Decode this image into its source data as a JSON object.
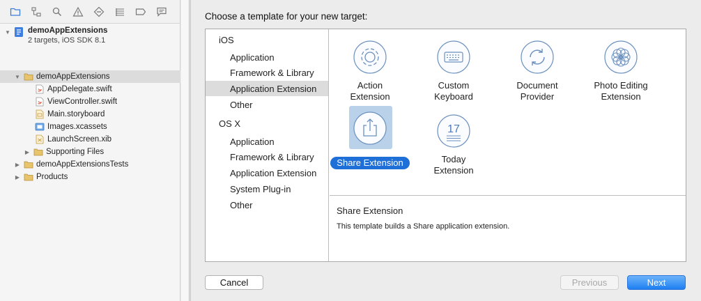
{
  "navigator": {
    "toolbar_icons": [
      "folder-icon",
      "hierarchy-icon",
      "search-icon",
      "warning-icon",
      "test-icon",
      "debug-icon",
      "breakpoint-icon",
      "report-icon"
    ],
    "project": {
      "name": "demoAppExtensions",
      "subtitle": "2 targets, iOS SDK 8.1"
    },
    "items": [
      {
        "label": "demoAppExtensions"
      },
      {
        "label": "AppDelegate.swift"
      },
      {
        "label": "ViewController.swift"
      },
      {
        "label": "Main.storyboard"
      },
      {
        "label": "Images.xcassets"
      },
      {
        "label": "LaunchScreen.xib"
      },
      {
        "label": "Supporting Files"
      },
      {
        "label": "demoAppExtensionsTests"
      },
      {
        "label": "Products"
      }
    ]
  },
  "sheet": {
    "title": "Choose a template for your new target:",
    "sidebar": {
      "ios_header": "iOS",
      "ios_items": [
        "Application",
        "Framework & Library",
        "Application Extension",
        "Other"
      ],
      "osx_header": "OS X",
      "osx_items": [
        "Application",
        "Framework & Library",
        "Application Extension",
        "System Plug-in",
        "Other"
      ]
    },
    "templates": [
      {
        "line1": "Action",
        "line2": "Extension",
        "icon": "gear-icon"
      },
      {
        "line1": "Custom",
        "line2": "Keyboard",
        "icon": "keyboard-icon"
      },
      {
        "line1": "Document",
        "line2": "Provider",
        "icon": "sync-icon"
      },
      {
        "line1": "Photo Editing",
        "line2": "Extension",
        "icon": "flower-icon"
      },
      {
        "line1": "Share Extension",
        "icon": "share-icon"
      },
      {
        "line1": "Today",
        "line2": "Extension",
        "icon": "calendar-icon",
        "day": "17"
      }
    ],
    "description": {
      "title": "Share Extension",
      "text": "This template builds a Share application extension."
    },
    "buttons": {
      "cancel": "Cancel",
      "previous": "Previous",
      "next": "Next"
    }
  },
  "colors": {
    "accent": "#1f6fd8",
    "selection": "#dcdcdc",
    "icon_stroke": "#6a8fbf"
  }
}
